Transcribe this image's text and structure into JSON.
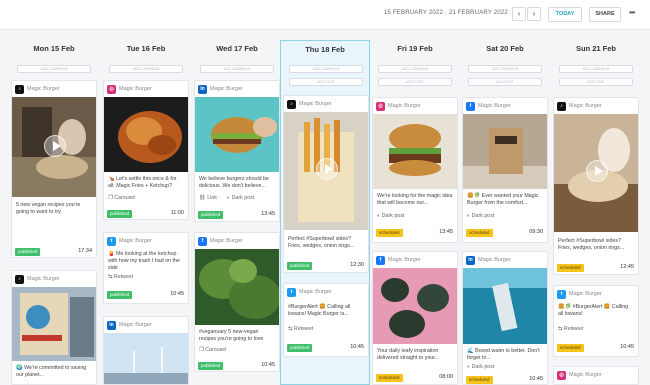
{
  "header": {
    "date_range": "15 FEBRUARY 2022  ·  21 FEBRUARY 2022",
    "prev_icon": "chevron-left-icon",
    "next_icon": "chevron-right-icon",
    "today_label": "TODAY",
    "share_label": "SHARE",
    "more_icon": "more-horizontal-icon"
  },
  "colors": {
    "accent": "#2aa3c9",
    "published": "#3fbf6a",
    "scheduled": "#f6c31b",
    "today_bg": "#e8f6fb"
  },
  "days": [
    {
      "label": "Mon 15 Feb",
      "today": false
    },
    {
      "label": "Tue 16 Feb",
      "today": false
    },
    {
      "label": "Wed 17 Feb",
      "today": false
    },
    {
      "label": "Thu 18 Feb",
      "today": true
    },
    {
      "label": "Fri 19 Feb",
      "today": false
    },
    {
      "label": "Sat 20 Feb",
      "today": false
    },
    {
      "label": "Sun 21 Feb",
      "today": false
    }
  ],
  "slots": {
    "add_campaign": "ADD CAMPAIGN",
    "add_post": "ADD POST"
  },
  "posts": {
    "mon_1": {
      "network": "tiktok",
      "account": "Magic Burger",
      "caption": "5 new vegan recipes you're going to want to try",
      "status": "published",
      "time": "17:34"
    },
    "mon_2": {
      "network": "tiktok",
      "account": "Magic Burger",
      "caption": "🌍 We're committed to saving our planet..."
    },
    "tue_1": {
      "network": "instagram",
      "account": "Magic Burger",
      "caption": "🍗 Let's settle this once & for all: Magic Fries + Ketchup?",
      "type": "Carousel",
      "status": "published",
      "time": "11:00"
    },
    "tue_2": {
      "network": "twitter",
      "account": "Magic Burger",
      "caption": "🍟 Me looking at the ketchup with how my trash I had on the side",
      "type": "Retweet",
      "status": "published",
      "time": "10:45"
    },
    "tue_3": {
      "network": "linkedin",
      "account": "Magic Burger"
    },
    "wed_1": {
      "network": "linkedin",
      "account": "Magic Burger",
      "caption": "We believe burgers should be delicious. We don't believe...",
      "type": "Link",
      "type2": "Dark post",
      "status": "published",
      "time": "13:45"
    },
    "wed_2": {
      "network": "facebook",
      "account": "Magic Burger",
      "caption": "#veganuary 5 new-vegan recipes you're going to love",
      "type": "Carousel",
      "status": "published",
      "time": "10:45"
    },
    "thu_1": {
      "network": "tiktok",
      "account": "Magic Burger",
      "caption": "Perfect #Superbowl sides? Fries, wedges, onion rings...",
      "status": "published",
      "time": "12:30"
    },
    "thu_2": {
      "network": "twitter",
      "account": "Magic Burger",
      "caption": "#BurgerAlert 🍔 Calling all lowans! Magic Burger is...",
      "type": "Retweet",
      "status": "published",
      "time": "10:45"
    },
    "fri_1": {
      "network": "instagram",
      "account": "Magic Burger",
      "caption": "We're looking for the magic idea that will become our...",
      "type": "Dark post",
      "status": "scheduled",
      "time": "13:45"
    },
    "fri_2": {
      "network": "facebook",
      "account": "Magic Burger",
      "caption": "Your daily leafy inspiration delivered straight to your...",
      "status": "scheduled",
      "time": "08:00"
    },
    "sat_1": {
      "network": "facebook",
      "account": "Magic Burger",
      "caption": "🍔🥬 Ever wanted your Magic Burger from the comfort...",
      "type": "Dark post",
      "status": "scheduled",
      "time": "09:30"
    },
    "sat_2": {
      "network": "linkedin",
      "account": "Magic Burger",
      "caption": "🌊 Boxed water is better. Don't forget to...",
      "type": "Dark post",
      "status": "scheduled",
      "time": "10:45"
    },
    "sun_1": {
      "network": "tiktok",
      "account": "Magic Burger",
      "caption": "Perfect #Superbowl sides? Fries, wedges, onion rings...",
      "status": "scheduled",
      "time": "12:45"
    },
    "sun_2": {
      "network": "twitter",
      "account": "Magic Burger",
      "caption": "🍔🥬 #BurgerAlert 🍔 Calling all lowans!",
      "type": "Retweet",
      "status": "scheduled",
      "time": "10:45"
    },
    "sun_3": {
      "network": "instagram",
      "account": "Magic Burger"
    }
  }
}
